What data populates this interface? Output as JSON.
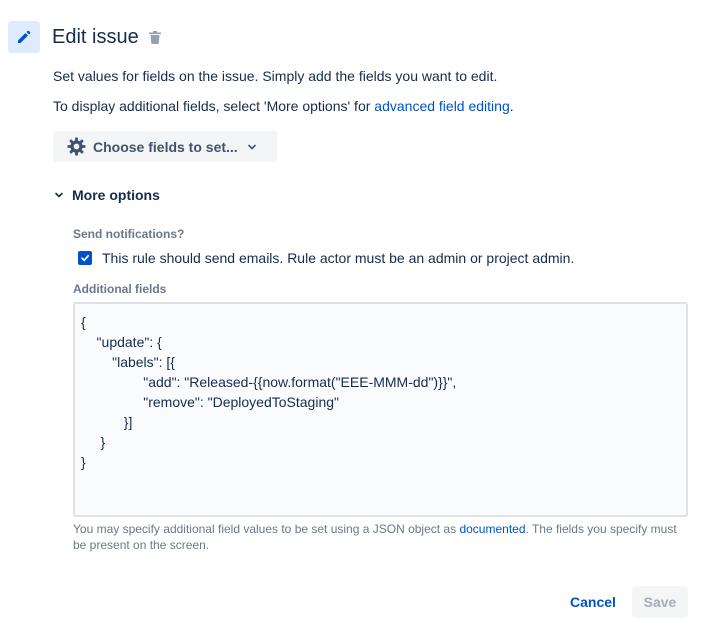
{
  "header": {
    "title": "Edit issue",
    "icon": "pencil-icon",
    "delete_icon": "trash-icon"
  },
  "description": {
    "line1": "Set values for fields on the issue. Simply add the fields you want to edit.",
    "line2_prefix": "To display additional fields, select 'More options' for ",
    "line2_link": "advanced field editing",
    "line2_suffix": "."
  },
  "choose_fields": {
    "label": "Choose fields to set...",
    "icon": "gear-icon"
  },
  "more_options": {
    "label": "More options",
    "expanded": true
  },
  "notifications": {
    "label": "Send notifications?",
    "checkbox_label": "This rule should send emails. Rule actor must be an admin or project admin.",
    "checked": true
  },
  "additional_fields": {
    "label": "Additional fields",
    "value": "{\n    \"update\": {\n        \"labels\": [{\n                \"add\": \"Released-{{now.format(\"EEE-MMM-dd\")}}\",\n                \"remove\": \"DeployedToStaging\"\n           }]\n     }\n}",
    "help_prefix": "You may specify additional field values to be set using a JSON object as ",
    "help_link": "documented",
    "help_suffix": ". The fields you specify must be present on the screen."
  },
  "footer": {
    "cancel_label": "Cancel",
    "save_label": "Save"
  },
  "colors": {
    "primary": "#0052cc",
    "text": "#172b4d",
    "subtle": "#6b778c",
    "icon_bg": "#deebff"
  }
}
